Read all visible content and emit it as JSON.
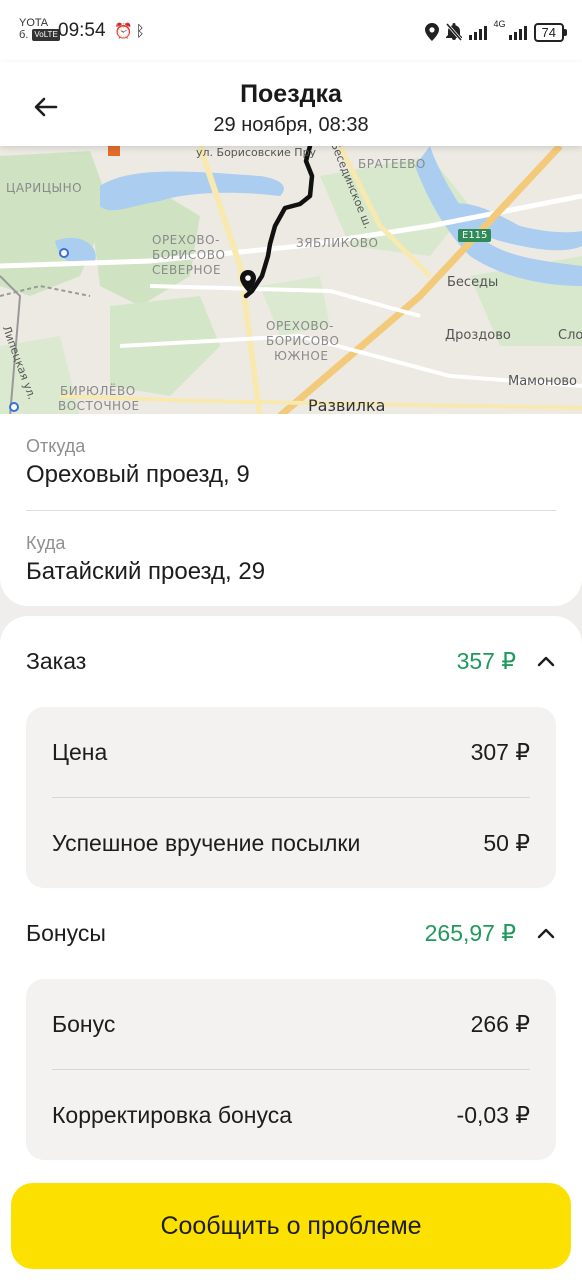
{
  "status_bar": {
    "carrier": "YOTA",
    "carrier_sub": "б.",
    "volte": "VoLTE",
    "time": "09:54",
    "network": "4G",
    "battery": "74"
  },
  "header": {
    "title": "Поездка",
    "subtitle": "29 ноября, 08:38"
  },
  "map": {
    "labels": {
      "tsaritsyno": "ЦАРИЦЫНО",
      "orekhovo_severnoe_1": "ОРЕХОВО-",
      "orekhovo_severnoe_2": "БОРИСОВО",
      "orekhovo_severnoe_3": "СЕВЕРНОЕ",
      "zyablikovo": "ЗЯБЛИКОВО",
      "brateevo": "БРАТЕЕВО",
      "orekhovo_yuzhnoe_1": "ОРЕХОВО-",
      "orekhovo_yuzhnoe_2": "БОРИСОВО",
      "orekhovo_yuzhnoe_3": "ЮЖНОЕ",
      "biryulevo_1": "БИРЮЛЁВО",
      "biryulevo_2": "ВОСТОЧНОЕ",
      "besedy": "Беседы",
      "drozdovo": "Дроздово",
      "mamonovo": "Мамоново",
      "slo": "Сло",
      "razvilka": "Развилка",
      "lipetskaya": "Липецкая ул.",
      "borisovskie": "ул. Борисовские Пру",
      "kashirskoe": "Бесединское ш.",
      "e115": "E115"
    }
  },
  "route": {
    "from_label": "Откуда",
    "from_value": "Ореховый проезд, 9",
    "to_label": "Куда",
    "to_value": "Батайский проезд, 29"
  },
  "order": {
    "title": "Заказ",
    "total": "357 ₽",
    "items": [
      {
        "label": "Цена",
        "value": "307 ₽"
      },
      {
        "label": "Успешное вручение посылки",
        "value": "50 ₽"
      }
    ]
  },
  "bonuses": {
    "title": "Бонусы",
    "total": "265,97 ₽",
    "items": [
      {
        "label": "Бонус",
        "value": "266 ₽"
      },
      {
        "label": "Корректировка бонуса",
        "value": "-0,03 ₽"
      }
    ]
  },
  "actions": {
    "report_label": "Сообщить о проблеме"
  },
  "colors": {
    "accent_yellow": "#fce000",
    "amount_green": "#1f9a5c"
  }
}
